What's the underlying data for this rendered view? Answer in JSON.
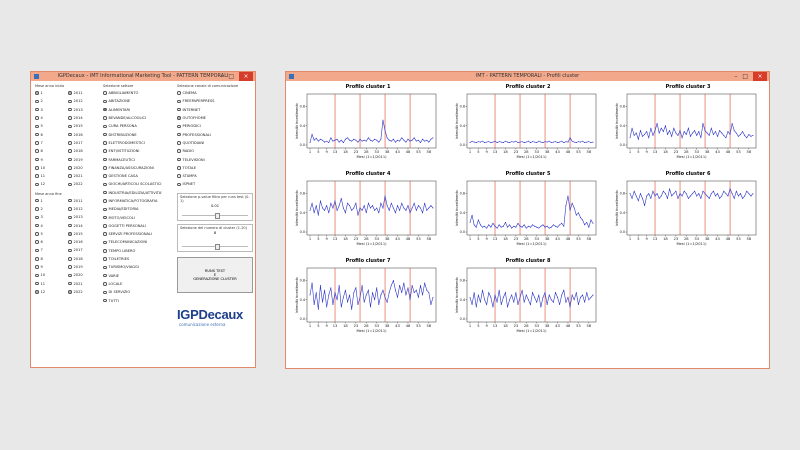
{
  "left_window": {
    "title": "IGPDecaux - IMT Informational Marketing Tool - PATTERN TEMPORALI",
    "mese_inizio_label": "Mese anno inizio",
    "mese_fine_label": "Mese anno fine",
    "months": [
      "1",
      "2",
      "3",
      "4",
      "5",
      "6",
      "7",
      "8",
      "9",
      "10",
      "11",
      "12"
    ],
    "years": [
      "2011",
      "2012",
      "2013",
      "2014",
      "2015",
      "2016",
      "2017",
      "2018",
      "2019",
      "2020",
      "2021",
      "2022"
    ],
    "start_month_selected": 0,
    "start_year_selected": 0,
    "end_month_selected": 11,
    "end_year_selected": 11,
    "end_year_selected2": 4,
    "settori_label": "Selezione settore",
    "settori": [
      "ABBIGLIAMENTO",
      "ABITAZIONE",
      "ALIMENTARI",
      "BEVANDE/ALCOOLICI",
      "CURA PERSONA",
      "DISTRIBUZIONE",
      "ELETTRODOMESTICI",
      "ENTI/ISTITUZIONI",
      "FARMACEUTICI",
      "FINANZA/ASSICURAZIONI",
      "GESTIONE CASA",
      "GIOCHI/ARTICOLI SCOLASTICI",
      "INDUSTRIA/EDILIZIA/ATTIVITA'",
      "INFORMATICA/FOTOGRAFIA",
      "MEDIA/EDITORIA",
      "MOTO/VEICOLI",
      "OGGETTI PERSONALI",
      "SERVIZI PROFESSIONALI",
      "TELECOMUNICAZIONI",
      "TEMPO LIBERO",
      "TOILETRIES",
      "TURISMO/VIAGGI",
      "VARIE",
      "LOCALE",
      "DI SERVIZIO",
      "TUTTI"
    ],
    "settore_selected": 2,
    "canali_label": "Selezione canale di comunicazione",
    "canali": [
      "CINEMA",
      "FREEPAPERPRESS",
      "INTERNET",
      "OUTOFHOME",
      "PERIODICI",
      "PROFESSIONALI",
      "QUOTIDIANI",
      "RADIO",
      "TELEVISIONI",
      "TOTALE",
      "STAMPA",
      "ISPNET"
    ],
    "canale_selected": 3,
    "pvalue_label": "Selezione p-value filtro per runs test (0-1)",
    "pvalue_value": "0.01",
    "cluster_label": "Selezione del numero di cluster (1-20)",
    "cluster_value": "8",
    "run_button": "RUNS TEST\nE\nGENERAZIONE CLUSTER",
    "logo_main": "IGPDecaux",
    "logo_sub": "comunicazione esterna"
  },
  "right_window": {
    "title": "IMT - PATTERN TEMPORALI - Profili cluster"
  },
  "chart_data": [
    {
      "type": "line",
      "title": "Profilo cluster 1",
      "xlabel": "Mesi (1=1/2011)",
      "ylabel": "Intensità investimento",
      "ylim": [
        0,
        1
      ],
      "x_ticks": [
        1,
        5,
        9,
        13,
        18,
        23,
        28,
        33,
        38,
        43,
        48,
        53,
        58
      ],
      "y_ticks": [
        0.0,
        0.4,
        0.8
      ],
      "vlines": [
        12,
        24,
        36,
        48
      ],
      "values": [
        0.05,
        0.22,
        0.1,
        0.14,
        0.08,
        0.12,
        0.1,
        0.06,
        0.08,
        0.05,
        0.15,
        0.08,
        0.1,
        0.12,
        0.06,
        0.1,
        0.05,
        0.12,
        0.15,
        0.1,
        0.08,
        0.12,
        0.1,
        0.06,
        0.12,
        0.08,
        0.1,
        0.08,
        0.15,
        0.1,
        0.08,
        0.12,
        0.1,
        0.06,
        0.12,
        0.52,
        0.3,
        0.15,
        0.1,
        0.08,
        0.12,
        0.06,
        0.1,
        0.08,
        0.15,
        0.1,
        0.06,
        0.12,
        0.08,
        0.1,
        0.15,
        0.08,
        0.1,
        0.05,
        0.12,
        0.08,
        0.1,
        0.06,
        0.12,
        0.15
      ]
    },
    {
      "type": "line",
      "title": "Profilo cluster 2",
      "xlabel": "Mesi (1=1/2011)",
      "ylabel": "Intensità investimento",
      "ylim": [
        0,
        1
      ],
      "x_ticks": [
        1,
        5,
        9,
        13,
        18,
        23,
        28,
        33,
        38,
        43,
        48,
        53,
        58
      ],
      "y_ticks": [
        0.0,
        0.4,
        0.8
      ],
      "vlines": [
        12,
        24,
        36,
        48
      ],
      "values": [
        0.05,
        0.08,
        0.06,
        0.05,
        0.07,
        0.06,
        0.08,
        0.05,
        0.06,
        0.07,
        0.05,
        0.06,
        0.08,
        0.05,
        0.07,
        0.06,
        0.05,
        0.08,
        0.06,
        0.05,
        0.07,
        0.06,
        0.08,
        0.05,
        0.06,
        0.07,
        0.05,
        0.06,
        0.08,
        0.05,
        0.07,
        0.06,
        0.05,
        0.08,
        0.06,
        0.05,
        0.07,
        0.06,
        0.08,
        0.05,
        0.06,
        0.07,
        0.05,
        0.06,
        0.08,
        0.05,
        0.07,
        0.06,
        0.15,
        0.08,
        0.06,
        0.05,
        0.07,
        0.06,
        0.08,
        0.05,
        0.06,
        0.07,
        0.05,
        0.06
      ]
    },
    {
      "type": "line",
      "title": "Profilo cluster 3",
      "xlabel": "Mesi (1=1/2011)",
      "ylabel": "Intensità investimento",
      "ylim": [
        0,
        1
      ],
      "x_ticks": [
        1,
        5,
        9,
        13,
        18,
        23,
        28,
        33,
        38,
        43,
        48,
        53,
        58
      ],
      "y_ticks": [
        0.0,
        0.4,
        0.8
      ],
      "vlines": [
        12,
        24,
        36,
        48
      ],
      "values": [
        0.15,
        0.35,
        0.2,
        0.25,
        0.12,
        0.3,
        0.18,
        0.22,
        0.28,
        0.15,
        0.35,
        0.2,
        0.3,
        0.45,
        0.25,
        0.35,
        0.28,
        0.4,
        0.22,
        0.3,
        0.18,
        0.35,
        0.25,
        0.2,
        0.3,
        0.15,
        0.28,
        0.22,
        0.35,
        0.18,
        0.25,
        0.3,
        0.2,
        0.28,
        0.15,
        0.45,
        0.3,
        0.25,
        0.2,
        0.35,
        0.22,
        0.28,
        0.18,
        0.3,
        0.25,
        0.2,
        0.15,
        0.28,
        0.22,
        0.45,
        0.3,
        0.25,
        0.18,
        0.22,
        0.28,
        0.2,
        0.15,
        0.22,
        0.18,
        0.2
      ]
    },
    {
      "type": "line",
      "title": "Profilo cluster 4",
      "xlabel": "Mesi (1=1/2011)",
      "ylabel": "Intensità investimento",
      "ylim": [
        0,
        1
      ],
      "x_ticks": [
        1,
        5,
        9,
        13,
        18,
        23,
        28,
        33,
        38,
        43,
        48,
        53,
        58
      ],
      "y_ticks": [
        0.0,
        0.4,
        0.8
      ],
      "vlines": [
        12,
        24,
        36,
        48
      ],
      "values": [
        0.45,
        0.6,
        0.4,
        0.55,
        0.35,
        0.65,
        0.5,
        0.45,
        0.55,
        0.4,
        0.6,
        0.5,
        0.65,
        0.45,
        0.55,
        0.7,
        0.5,
        0.4,
        0.6,
        0.55,
        0.45,
        0.5,
        0.6,
        0.35,
        0.5,
        0.45,
        0.55,
        0.4,
        0.6,
        0.5,
        0.55,
        0.45,
        0.5,
        0.4,
        0.6,
        0.5,
        0.75,
        0.55,
        0.45,
        0.6,
        0.5,
        0.4,
        0.55,
        0.45,
        0.6,
        0.5,
        0.45,
        0.55,
        0.4,
        0.5,
        0.6,
        0.45,
        0.55,
        0.5,
        0.4,
        0.6,
        0.45,
        0.5,
        0.55,
        0.5
      ]
    },
    {
      "type": "line",
      "title": "Profilo cluster 5",
      "xlabel": "Mesi (1=1/2011)",
      "ylabel": "Intensità investimento",
      "ylim": [
        0,
        1
      ],
      "x_ticks": [
        1,
        5,
        9,
        13,
        18,
        23,
        28,
        33,
        38,
        43,
        48,
        53,
        58
      ],
      "y_ticks": [
        0.0,
        0.4,
        0.8
      ],
      "vlines": [
        12,
        24,
        36,
        48
      ],
      "values": [
        0.2,
        0.35,
        0.15,
        0.1,
        0.25,
        0.15,
        0.1,
        0.12,
        0.08,
        0.15,
        0.1,
        0.18,
        0.12,
        0.08,
        0.15,
        0.1,
        0.12,
        0.2,
        0.1,
        0.15,
        0.08,
        0.12,
        0.1,
        0.18,
        0.12,
        0.1,
        0.15,
        0.08,
        0.12,
        0.1,
        0.15,
        0.12,
        0.1,
        0.08,
        0.12,
        0.15,
        0.1,
        0.12,
        0.08,
        0.1,
        0.15,
        0.12,
        0.1,
        0.15,
        0.18,
        0.12,
        0.55,
        0.75,
        0.45,
        0.6,
        0.5,
        0.35,
        0.4,
        0.3,
        0.25,
        0.15,
        0.2,
        0.1,
        0.25,
        0.18
      ]
    },
    {
      "type": "line",
      "title": "Profilo cluster 6",
      "xlabel": "Mesi (1=1/2011)",
      "ylabel": "Intensità investimento",
      "ylim": [
        0,
        1
      ],
      "x_ticks": [
        1,
        5,
        9,
        13,
        18,
        23,
        28,
        33,
        38,
        43,
        48,
        53,
        58
      ],
      "y_ticks": [
        0.0,
        0.4,
        0.8
      ],
      "vlines": [
        12,
        24,
        36,
        48
      ],
      "values": [
        0.8,
        0.7,
        0.85,
        0.75,
        0.65,
        0.8,
        0.7,
        0.55,
        0.75,
        0.8,
        0.7,
        0.85,
        0.75,
        0.8,
        0.7,
        0.75,
        0.85,
        0.8,
        0.7,
        0.9,
        0.75,
        0.8,
        0.85,
        0.7,
        0.8,
        0.75,
        0.85,
        0.8,
        0.7,
        0.75,
        0.8,
        0.85,
        0.75,
        0.8,
        0.7,
        0.85,
        0.8,
        0.75,
        0.7,
        0.8,
        0.85,
        0.75,
        0.8,
        0.7,
        0.75,
        0.85,
        0.8,
        0.75,
        0.9,
        0.8,
        0.7,
        0.85,
        0.75,
        0.8,
        0.7,
        0.75,
        0.85,
        0.8,
        0.75,
        0.8
      ]
    },
    {
      "type": "line",
      "title": "Profilo cluster 7",
      "xlabel": "Mesi (1=1/2011)",
      "ylabel": "Intensità investimento",
      "ylim": [
        0,
        1
      ],
      "x_ticks": [
        1,
        5,
        9,
        13,
        18,
        23,
        28,
        33,
        38,
        43,
        48,
        53,
        58
      ],
      "y_ticks": [
        0.0,
        0.4,
        0.8
      ],
      "vlines": [
        12,
        24,
        36,
        48
      ],
      "values": [
        0.5,
        0.75,
        0.3,
        0.55,
        0.2,
        0.7,
        0.35,
        0.6,
        0.25,
        0.5,
        0.65,
        0.3,
        0.55,
        0.4,
        0.7,
        0.25,
        0.45,
        0.6,
        0.35,
        0.5,
        0.2,
        0.55,
        0.65,
        0.3,
        0.45,
        0.7,
        0.35,
        0.5,
        0.6,
        0.25,
        0.55,
        0.4,
        0.65,
        0.3,
        0.5,
        0.6,
        0.45,
        0.35,
        0.55,
        0.7,
        0.8,
        0.6,
        0.45,
        0.7,
        0.55,
        0.75,
        0.5,
        0.65,
        0.4,
        0.7,
        0.55,
        0.6,
        0.45,
        0.7,
        0.5,
        0.75,
        0.6,
        0.55,
        0.3,
        0.45
      ]
    },
    {
      "type": "line",
      "title": "Profilo cluster 8",
      "xlabel": "Mesi (1=1/2011)",
      "ylabel": "Intensità investimento",
      "ylim": [
        0,
        1
      ],
      "x_ticks": [
        1,
        5,
        9,
        13,
        18,
        23,
        28,
        33,
        38,
        43,
        48,
        53,
        58
      ],
      "y_ticks": [
        0.0,
        0.4,
        0.8
      ],
      "vlines": [
        12,
        24,
        36,
        48
      ],
      "values": [
        0.45,
        0.3,
        0.55,
        0.25,
        0.5,
        0.35,
        0.6,
        0.4,
        0.3,
        0.55,
        0.45,
        0.25,
        0.5,
        0.35,
        0.6,
        0.3,
        0.45,
        0.55,
        0.25,
        0.4,
        0.5,
        0.35,
        0.55,
        0.3,
        0.45,
        0.6,
        0.35,
        0.5,
        0.4,
        0.3,
        0.55,
        0.45,
        0.35,
        0.5,
        0.25,
        0.45,
        0.55,
        0.3,
        0.5,
        0.4,
        0.35,
        0.55,
        0.45,
        0.3,
        0.5,
        0.6,
        0.35,
        0.45,
        0.25,
        0.5,
        0.4,
        0.55,
        0.3,
        0.45,
        0.5,
        0.35,
        0.55,
        0.4,
        0.45,
        0.5
      ]
    }
  ]
}
